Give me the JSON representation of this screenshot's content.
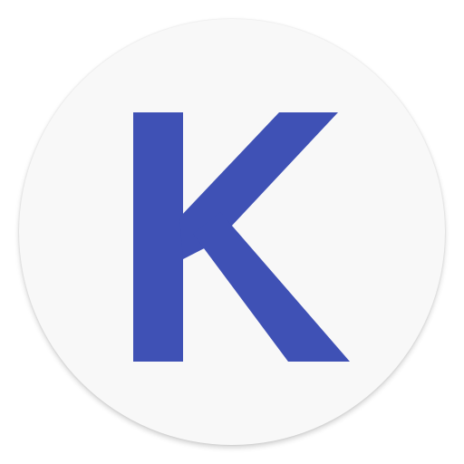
{
  "icon": {
    "letter": "K",
    "letter_color": "#3f51b5",
    "background_color": "#f8f8f8",
    "shape": "circle"
  }
}
